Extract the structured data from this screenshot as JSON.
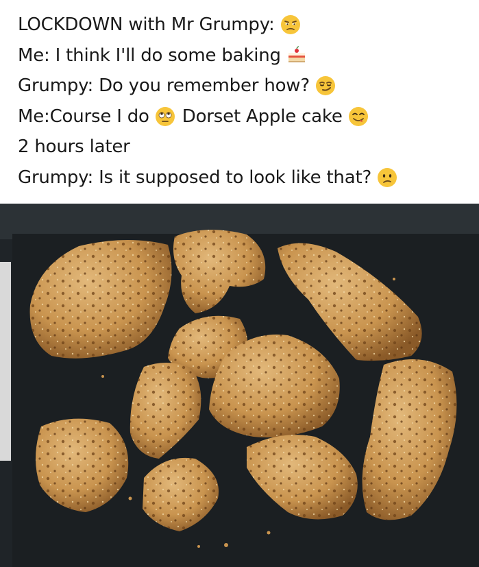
{
  "post": {
    "lines": [
      {
        "text": "LOCKDOWN with Mr Grumpy:",
        "emoji": "unamused-face-emoji"
      },
      {
        "text": "Me: I think I'll do some baking",
        "emoji": "cake-slice-emoji"
      },
      {
        "text": "Grumpy: Do you remember how?",
        "emoji": "smirking-face-emoji"
      },
      {
        "text": "Me:Course I do",
        "emoji": "eye-roll-face-emoji",
        "text_after": "Dorset Apple cake",
        "emoji_after": "savoring-food-face-emoji"
      },
      {
        "text": "2 hours later"
      },
      {
        "text": "Grumpy: Is it supposed to look like that?",
        "emoji": "confused-face-emoji"
      }
    ]
  },
  "photo": {
    "subject_icon": "broken-cake-photo",
    "colors": {
      "board": "#1f2428",
      "board_edge": "#2c3236",
      "cake": "#c9944f",
      "cake_dark": "#7a4a1e",
      "cake_light": "#e2b87a",
      "foil": "#d9d9d9"
    }
  }
}
